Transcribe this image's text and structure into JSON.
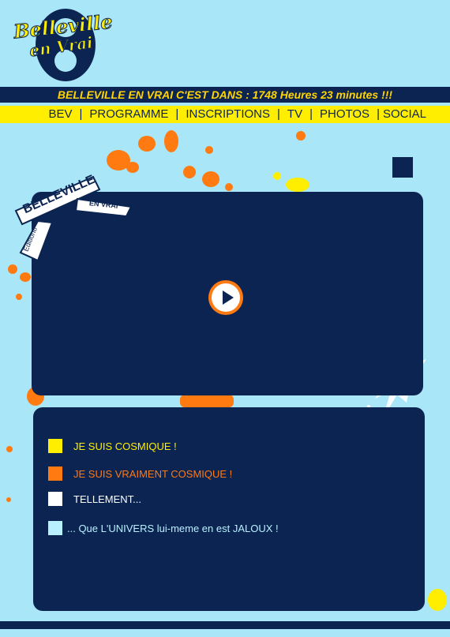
{
  "logo": {
    "line1": "Belleville",
    "line2": "en Vrai",
    "number": "8"
  },
  "countdown": {
    "text": "BELLEVILLE EN VRAI C'EST DANS : 1748 Heures 23 minutes !!!"
  },
  "nav": {
    "items": [
      "BEV",
      "PROGRAMME",
      "INSCRIPTIONS",
      "TV",
      "PHOTOS",
      "SOCIAL"
    ],
    "separator": "|"
  },
  "badge": {
    "title": "BELLEVILLE",
    "subtitle": "EN VRAI",
    "edition": "Edition8"
  },
  "video": {
    "play_icon": "play-icon"
  },
  "list": {
    "items": [
      {
        "label": "JE SUIS COSMIQUE !",
        "color": "#ffee00"
      },
      {
        "label": "JE SUIS VRAIMENT COSMIQUE !",
        "color": "#ff7a10"
      },
      {
        "label": "TELLEMENT...",
        "color": "#ffffff"
      },
      {
        "label": "... Que L'UNIVERS lui-meme en est JALOUX !",
        "color": "#b8f0ff"
      }
    ]
  },
  "colors": {
    "background": "#a9e6f7",
    "navy": "#0c2452",
    "yellow": "#ffee00",
    "orange": "#ff7a10"
  }
}
